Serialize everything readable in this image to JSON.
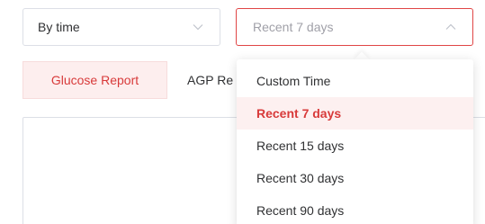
{
  "mode_select": {
    "value": "By time",
    "icon": "chevron-down-icon"
  },
  "range_select": {
    "value": "Recent 7 days",
    "icon": "chevron-up-icon",
    "focused": true
  },
  "tabs": [
    {
      "label": "Glucose Report",
      "active": true
    },
    {
      "label": "AGP Re",
      "active": false
    }
  ],
  "dropdown": {
    "options": [
      {
        "label": "Custom Time",
        "selected": false
      },
      {
        "label": "Recent 7 days",
        "selected": true
      },
      {
        "label": "Recent 15 days",
        "selected": false
      },
      {
        "label": "Recent 30 days",
        "selected": false
      },
      {
        "label": "Recent 90 days",
        "selected": false
      }
    ]
  },
  "colors": {
    "accent": "#d83a3a",
    "accent_bg": "#fdeeee",
    "border": "#dcdfe6",
    "focus_border": "#e04545"
  }
}
